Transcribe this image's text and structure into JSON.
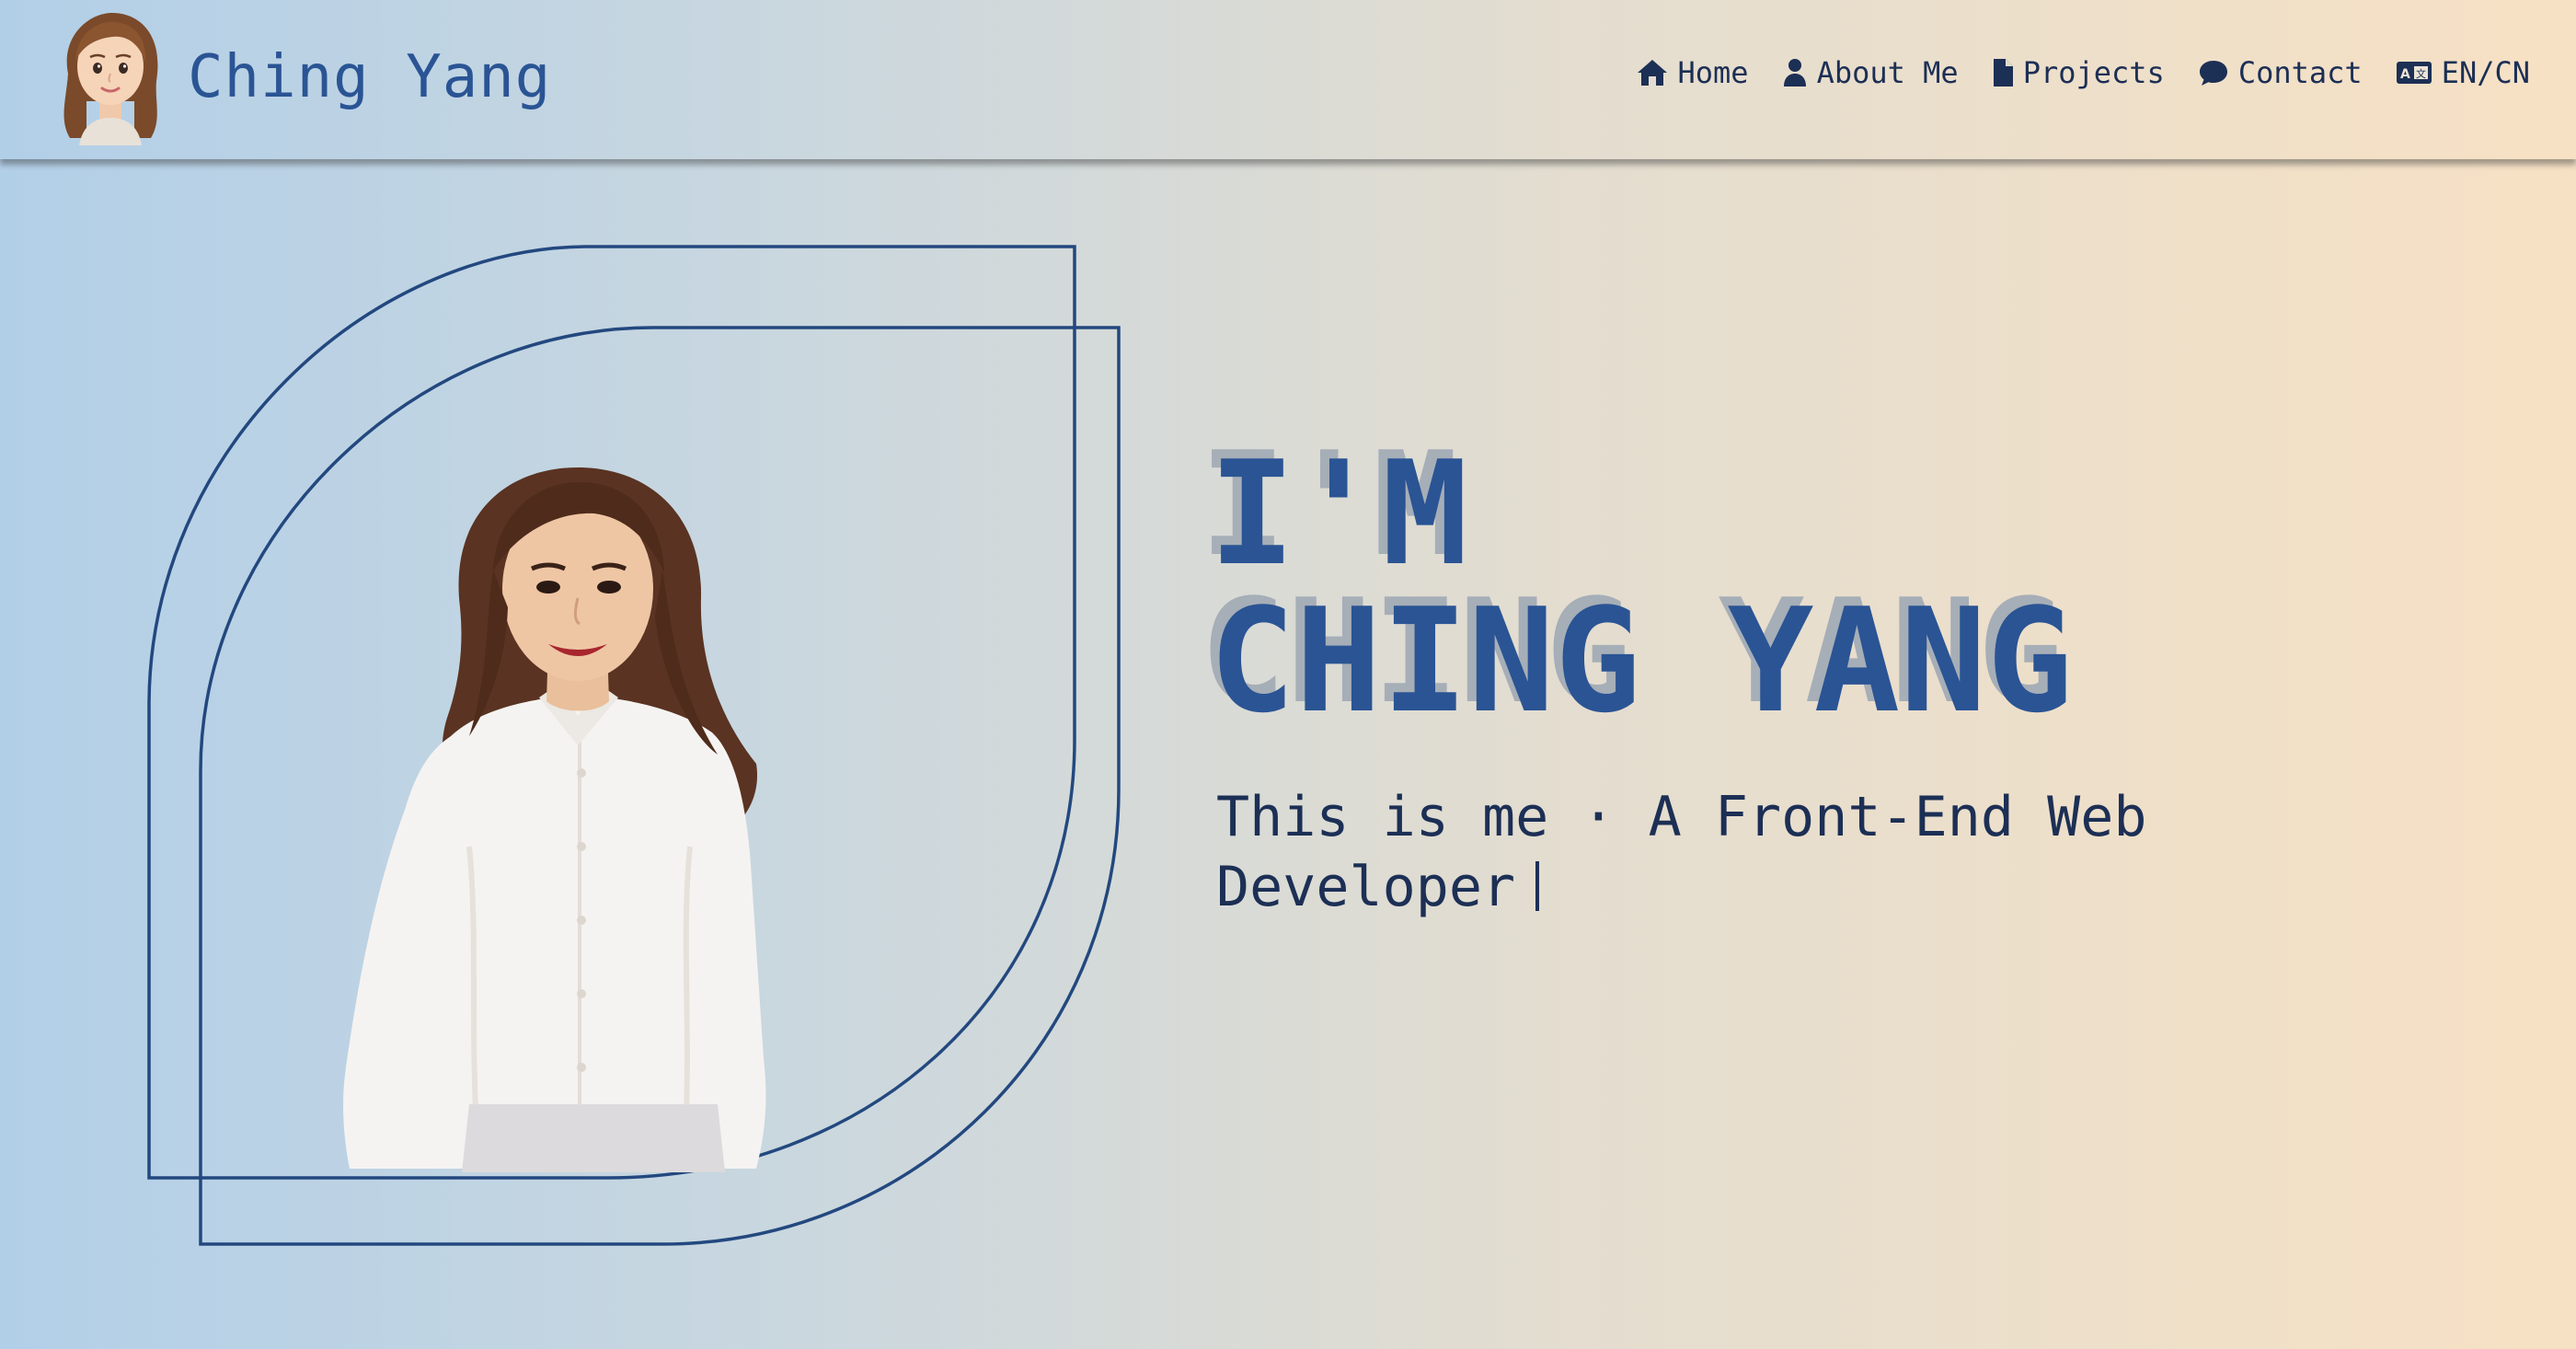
{
  "header": {
    "brand_name": "Ching Yang",
    "avatar_icon": "memoji-avatar-icon"
  },
  "nav": {
    "items": [
      {
        "label": "Home",
        "icon": "home-icon"
      },
      {
        "label": "About Me",
        "icon": "user-icon"
      },
      {
        "label": "Projects",
        "icon": "file-icon"
      },
      {
        "label": "Contact",
        "icon": "chat-bubble-icon"
      },
      {
        "label": "EN/CN",
        "icon": "language-card-icon"
      }
    ]
  },
  "hero": {
    "headline_line1": "I'M",
    "headline_line2": "CHING YANG",
    "subtitle_line1": "This is me · A Front-End Web",
    "subtitle_line2": "Developer"
  },
  "colors": {
    "primary": "#2a5494",
    "text_dark": "#1c2f55",
    "headline_shadow": "#a6aeb7",
    "gradient_left": "#b2cfe8",
    "gradient_right": "#f7e1c4"
  }
}
